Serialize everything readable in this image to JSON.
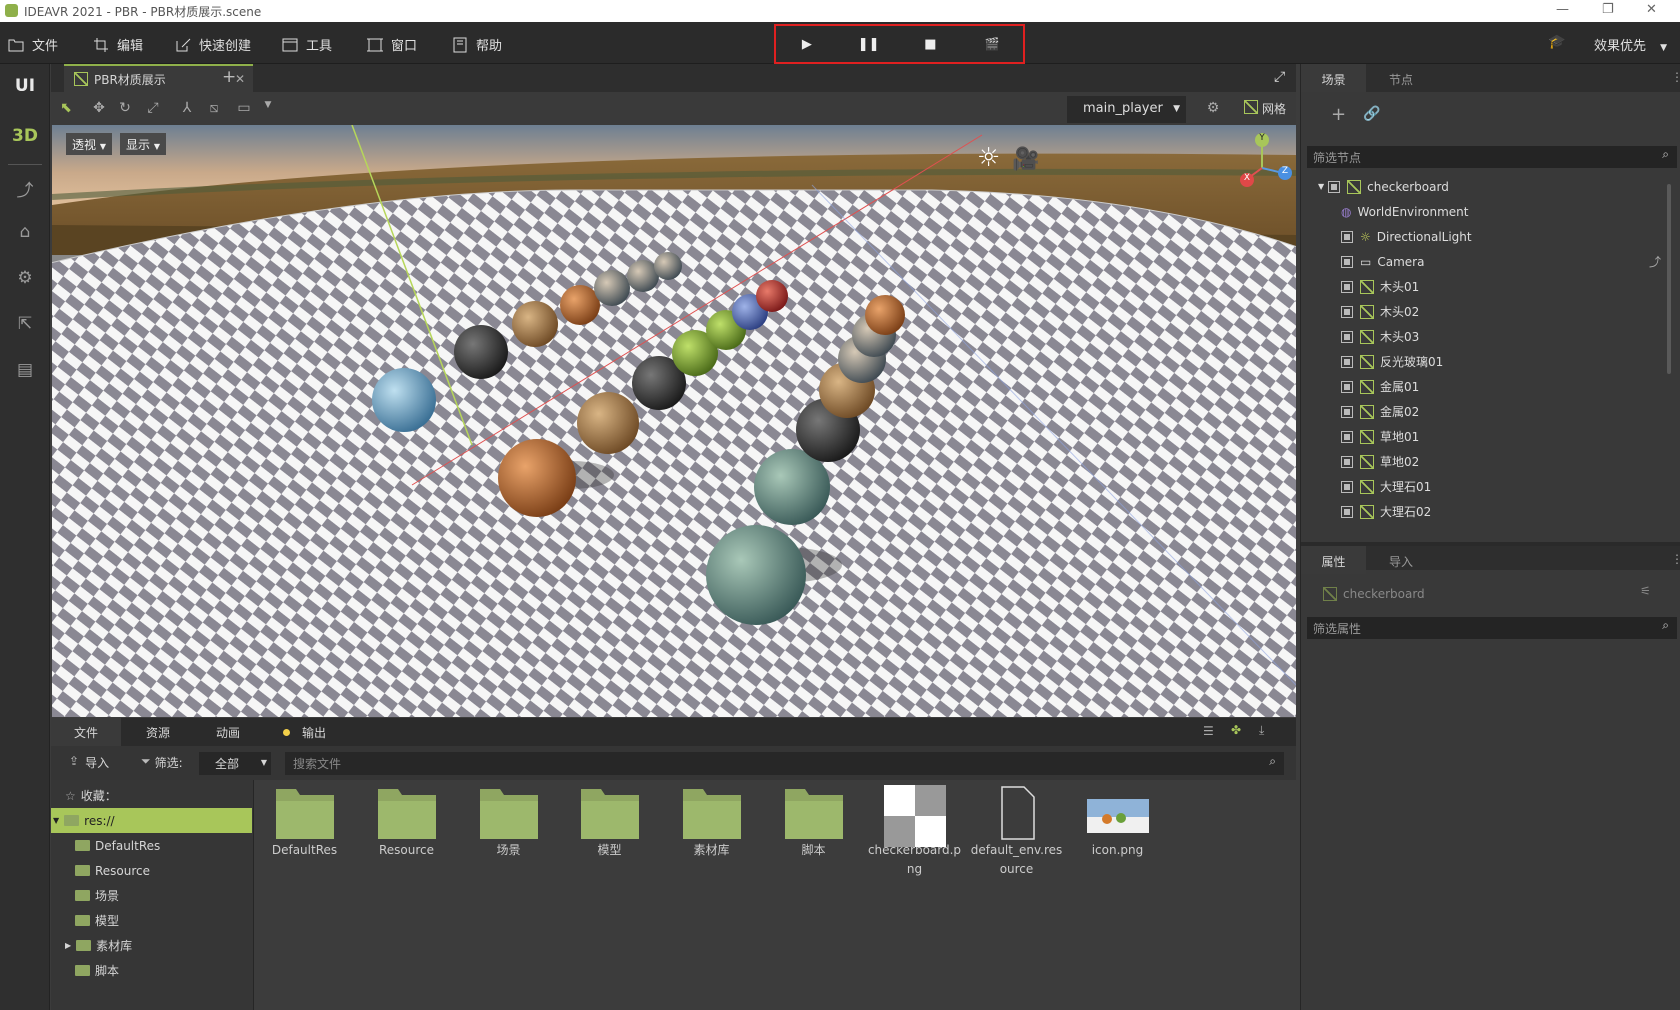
{
  "window": {
    "title": "IDEAVR 2021 - PBR - PBR材质展示.scene"
  },
  "menu": {
    "items": [
      {
        "label": "文件",
        "icon": "folder-icon"
      },
      {
        "label": "编辑",
        "icon": "crop-icon"
      },
      {
        "label": "快速创建",
        "icon": "edit-icon"
      },
      {
        "label": "工具",
        "icon": "window-icon"
      },
      {
        "label": "窗口",
        "icon": "frame-icon"
      },
      {
        "label": "帮助",
        "icon": "book-icon"
      }
    ],
    "render_mode": "效果优先"
  },
  "playback": {
    "play": "▶",
    "pause": "❚❚",
    "stop": "■",
    "record": "🎬"
  },
  "leftbar": {
    "ui": "UI",
    "d3": "3D"
  },
  "doc": {
    "tab": "PBR材质展示"
  },
  "viewport": {
    "player": "main_player",
    "grid": "网格",
    "persp": "透视",
    "display": "显示",
    "axis_x": "X",
    "axis_y": "Y",
    "axis_z": "Z"
  },
  "bottom": {
    "tabs": [
      "文件",
      "资源",
      "动画",
      "输出"
    ],
    "import": "导入",
    "filter": "筛选:",
    "filter_value": "全部",
    "search_placeholder": "搜索文件",
    "favorites": "收藏：",
    "tree": [
      "res://",
      "DefaultRes",
      "Resource",
      "场景",
      "模型",
      "素材库",
      "脚本"
    ],
    "files": [
      "DefaultRes",
      "Resource",
      "场景",
      "模型",
      "素材库",
      "脚本",
      "checkerboard.p ng",
      "default_env.res ource",
      "icon.png"
    ]
  },
  "scene": {
    "tabs": [
      "场景",
      "节点"
    ],
    "filter_placeholder": "筛选节点",
    "nodes": [
      "checkerboard",
      "WorldEnvironment",
      "DirectionalLight",
      "Camera",
      "木头01",
      "木头02",
      "木头03",
      "反光玻璃01",
      "金属01",
      "金属02",
      "草地01",
      "草地02",
      "大理石01",
      "大理石02"
    ]
  },
  "props": {
    "tabs": [
      "属性",
      "导入"
    ],
    "selected": "checkerboard",
    "filter_placeholder": "筛选属性"
  }
}
